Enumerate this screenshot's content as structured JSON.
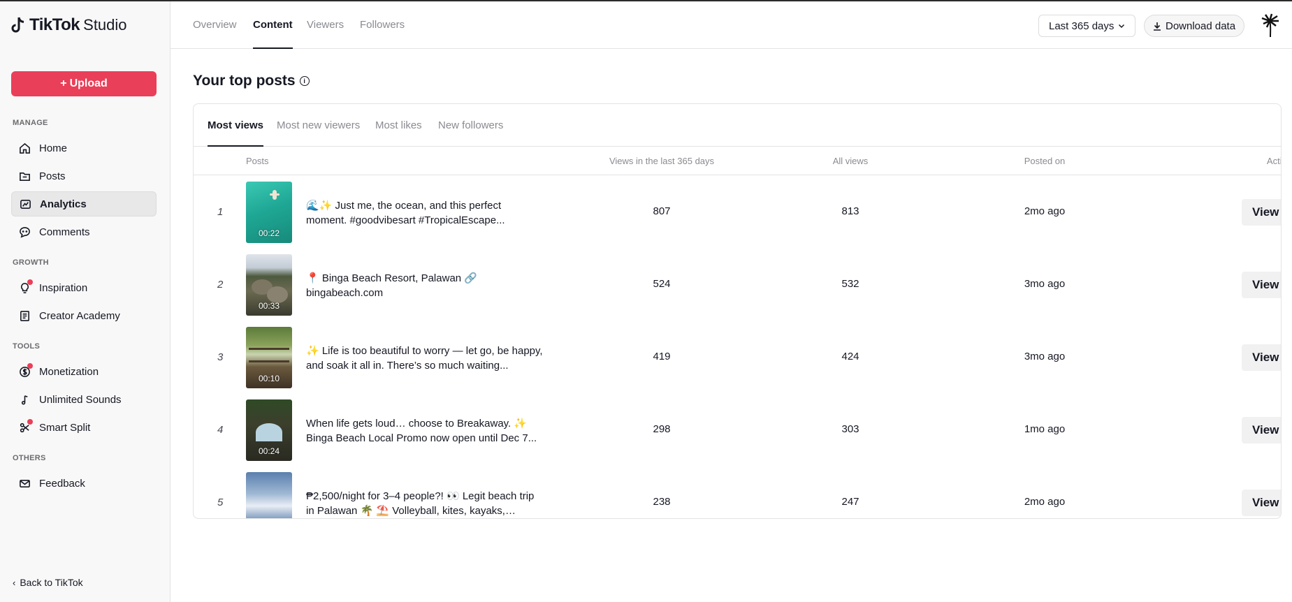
{
  "app": {
    "logo_main": "TikTok",
    "logo_sub": "Studio"
  },
  "sidebar": {
    "upload_label": "Upload",
    "sections": {
      "manage": "MANAGE",
      "growth": "GROWTH",
      "tools": "TOOLS",
      "others": "OTHERS"
    },
    "items": [
      {
        "label": "Home",
        "icon": "home-icon"
      },
      {
        "label": "Posts",
        "icon": "posts-icon"
      },
      {
        "label": "Analytics",
        "icon": "analytics-icon",
        "active": true
      },
      {
        "label": "Comments",
        "icon": "comments-icon"
      },
      {
        "label": "Inspiration",
        "icon": "lightbulb-icon",
        "badge": true
      },
      {
        "label": "Creator Academy",
        "icon": "academy-icon"
      },
      {
        "label": "Monetization",
        "icon": "dollar-icon",
        "badge": true
      },
      {
        "label": "Unlimited Sounds",
        "icon": "music-note-icon"
      },
      {
        "label": "Smart Split",
        "icon": "scissors-icon",
        "badge": true
      },
      {
        "label": "Feedback",
        "icon": "mail-icon"
      }
    ],
    "back_label": "Back to TikTok"
  },
  "header": {
    "tabs": [
      "Overview",
      "Content",
      "Viewers",
      "Followers"
    ],
    "active_tab": "Content",
    "range_label": "Last 365 days",
    "download_label": "Download data"
  },
  "main": {
    "title": "Your top posts",
    "subtabs": [
      "Most views",
      "Most new viewers",
      "Most likes",
      "New followers"
    ],
    "active_subtab": "Most views",
    "columns": {
      "posts": "Posts",
      "views_period": "Views in the last 365 days",
      "all_views": "All views",
      "posted_on": "Posted on",
      "action": "Action"
    },
    "rows": [
      {
        "rank": "1",
        "duration": "00:22",
        "caption": "🌊✨ Just me, the ocean, and this perfect moment. #goodvibesart #TropicalEscape...",
        "views_period": "807",
        "all_views": "813",
        "posted_on": "2mo ago",
        "action": "View data"
      },
      {
        "rank": "2",
        "duration": "00:33",
        "caption": "📍 Binga Beach Resort, Palawan 🔗 bingabeach.com",
        "views_period": "524",
        "all_views": "532",
        "posted_on": "3mo ago",
        "action": "View data"
      },
      {
        "rank": "3",
        "duration": "00:10",
        "caption": "✨ Life is too beautiful to worry — let go, be happy, and soak it all in. There’s so much waiting...",
        "views_period": "419",
        "all_views": "424",
        "posted_on": "3mo ago",
        "action": "View data"
      },
      {
        "rank": "4",
        "duration": "00:24",
        "caption": "When life gets loud… choose to Breakaway. ✨ Binga Beach Local Promo now open until Dec 7...",
        "views_period": "298",
        "all_views": "303",
        "posted_on": "1mo ago",
        "action": "View data"
      },
      {
        "rank": "5",
        "duration": "",
        "caption": "₱2,500/night for 3–4 people?! 👀 Legit beach trip in Palawan 🌴 ⛱️ Volleyball, kites, kayaks, floatie...",
        "views_period": "238",
        "all_views": "247",
        "posted_on": "2mo ago",
        "action": "View data"
      }
    ]
  },
  "colors": {
    "accent": "#ea3f58",
    "text": "#161823",
    "muted": "#8a8b91"
  }
}
